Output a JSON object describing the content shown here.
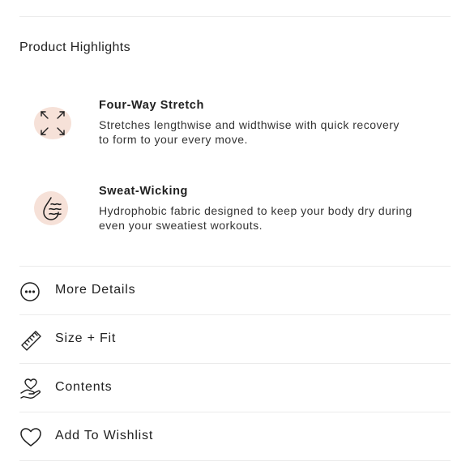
{
  "highlights": {
    "title": "Product Highlights",
    "items": [
      {
        "icon": "four-way-arrows-icon",
        "title": "Four-Way Stretch",
        "desc_line1": "Stretches lengthwise and widthwise with quick recovery",
        "desc_line2": "to form to your every move."
      },
      {
        "icon": "sweat-drop-icon",
        "title": "Sweat-Wicking",
        "desc_line1": "Hydrophobic fabric designed to keep your body dry during",
        "desc_line2": "even your sweatiest workouts."
      }
    ]
  },
  "accordion": [
    {
      "icon": "more-dots-icon",
      "label": "More Details"
    },
    {
      "icon": "ruler-icon",
      "label": "Size + Fit"
    },
    {
      "icon": "hand-heart-icon",
      "label": "Contents"
    },
    {
      "icon": "heart-icon",
      "label": "Add To Wishlist"
    }
  ],
  "colors": {
    "accent_blob": "#f6e1d8",
    "divider": "#ebebeb",
    "text": "#1f1f1f"
  }
}
